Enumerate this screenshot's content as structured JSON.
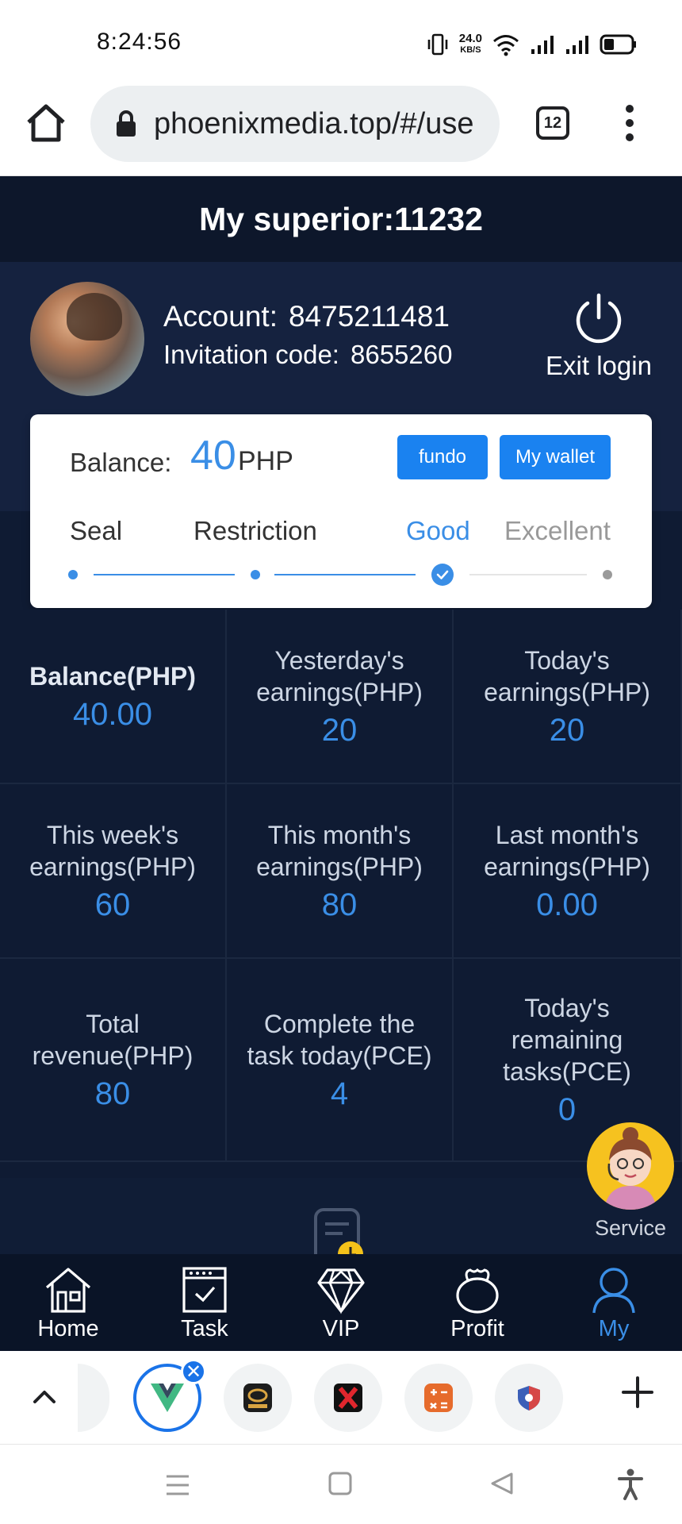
{
  "status_bar": {
    "time": "8:24:56",
    "net_speed_value": "24.0",
    "net_speed_unit": "KB/S"
  },
  "browser": {
    "url": "phoenixmedia.top/#/use",
    "tab_count": "12"
  },
  "header": {
    "superior": "My superior:11232"
  },
  "profile": {
    "account_label": "Account:",
    "account_value": "8475211481",
    "invitation_label": "Invitation code:",
    "invitation_value": "8655260",
    "exit_label": "Exit login"
  },
  "balance_card": {
    "balance_label": "Balance:",
    "balance_value": "40",
    "balance_unit": "PHP",
    "fundo_label": "fundo",
    "wallet_label": "My wallet",
    "levels": [
      "Seal",
      "Restriction",
      "Good",
      "Excellent"
    ],
    "current_level": "Good"
  },
  "stats": [
    {
      "label": "Balance(PHP)",
      "value": "40.00"
    },
    {
      "label": "Yesterday's earnings(PHP)",
      "value": "20"
    },
    {
      "label": "Today's earnings(PHP)",
      "value": "20"
    },
    {
      "label": "This week's earnings(PHP)",
      "value": "60"
    },
    {
      "label": "This month's earnings(PHP)",
      "value": "80"
    },
    {
      "label": "Last month's earnings(PHP)",
      "value": "0.00"
    },
    {
      "label": "Total revenue(PHP)",
      "value": "80"
    },
    {
      "label": "Complete the task today(PCE)",
      "value": "4"
    },
    {
      "label": "Today's remaining tasks(PCE)",
      "value": "0"
    }
  ],
  "service": {
    "label": "Service"
  },
  "tabbar": [
    {
      "label": "Home",
      "icon": "home-icon"
    },
    {
      "label": "Task",
      "icon": "task-icon"
    },
    {
      "label": "VIP",
      "icon": "diamond-icon"
    },
    {
      "label": "Profit",
      "icon": "bag-icon"
    },
    {
      "label": "My",
      "icon": "person-icon",
      "active": true
    }
  ],
  "colors": {
    "accent": "#3a8ee6",
    "button": "#1a82f0",
    "page_bg": "#0f1b33",
    "header_bg": "#0d172b",
    "chrome_blue": "#1a73e8"
  }
}
